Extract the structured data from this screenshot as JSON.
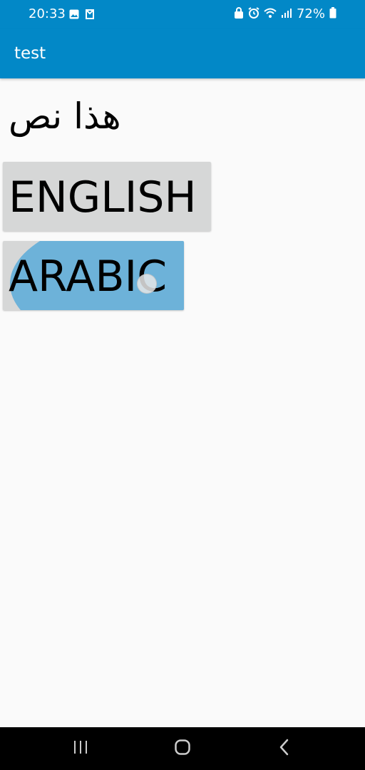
{
  "status_bar": {
    "time": "20:33",
    "battery": "72%",
    "left_icons": [
      "gallery-icon",
      "notification-icon"
    ],
    "right_icons": [
      "lock-icon",
      "alarm-icon",
      "wifi-icon",
      "signal-icon",
      "battery-icon"
    ]
  },
  "app_bar": {
    "title": "test",
    "color": "#0288c7"
  },
  "content": {
    "arabic_text": "هذا نص",
    "buttons": [
      {
        "label": "ENGLISH",
        "state": "normal"
      },
      {
        "label": "ARABIC",
        "state": "pressed"
      }
    ]
  },
  "nav_bar": {
    "buttons": [
      "recent-apps-icon",
      "home-icon",
      "back-icon"
    ]
  }
}
